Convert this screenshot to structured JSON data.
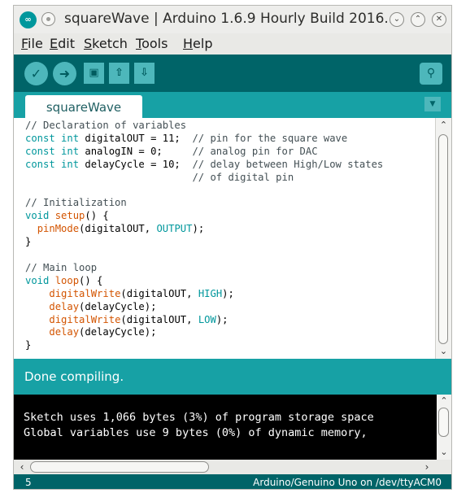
{
  "window": {
    "logo_text": "∞",
    "title": "squareWave | Arduino 1.6.9 Hourly Build 2016...",
    "minimize_icon": "chevron-down-icon",
    "maximize_icon": "chevron-up-icon",
    "close_icon": "close-icon"
  },
  "menu": {
    "items": [
      {
        "key": "F",
        "rest": "ile"
      },
      {
        "key": "E",
        "rest": "dit"
      },
      {
        "key": "S",
        "rest": "ketch"
      },
      {
        "key": "T",
        "rest": "ools"
      },
      {
        "key": "H",
        "rest": "elp"
      }
    ]
  },
  "toolbar": {
    "buttons": [
      "verify-icon",
      "upload-icon",
      "new-icon",
      "open-icon",
      "save-icon"
    ],
    "monitor_icon": "serial-monitor-icon"
  },
  "tabs": [
    {
      "label": "squareWave"
    }
  ],
  "code_lines": [
    [
      {
        "t": "// Declaration of variables",
        "c": "com"
      }
    ],
    [
      {
        "t": "const int ",
        "c": "kw"
      },
      {
        "t": "digitalOUT = 11;  ",
        "c": ""
      },
      {
        "t": "// pin for the square wave",
        "c": "com"
      }
    ],
    [
      {
        "t": "const int ",
        "c": "kw"
      },
      {
        "t": "analogIN = 0;     ",
        "c": ""
      },
      {
        "t": "// analog pin for DAC",
        "c": "com"
      }
    ],
    [
      {
        "t": "const int ",
        "c": "kw"
      },
      {
        "t": "delayCycle = 10;  ",
        "c": ""
      },
      {
        "t": "// delay between High/Low states",
        "c": "com"
      }
    ],
    [
      {
        "t": "                            // of digital pin",
        "c": "com"
      }
    ],
    [],
    [
      {
        "t": "// Initialization",
        "c": "com"
      }
    ],
    [
      {
        "t": "void ",
        "c": "kw"
      },
      {
        "t": "setup",
        "c": "fn"
      },
      {
        "t": "() {",
        "c": ""
      }
    ],
    [
      {
        "t": "  ",
        "c": ""
      },
      {
        "t": "pinMode",
        "c": "fn"
      },
      {
        "t": "(digitalOUT, ",
        "c": ""
      },
      {
        "t": "OUTPUT",
        "c": "kw"
      },
      {
        "t": ");",
        "c": ""
      }
    ],
    [
      {
        "t": "}",
        "c": ""
      }
    ],
    [],
    [
      {
        "t": "// Main loop",
        "c": "com"
      }
    ],
    [
      {
        "t": "void ",
        "c": "kw"
      },
      {
        "t": "loop",
        "c": "fn"
      },
      {
        "t": "() {",
        "c": ""
      }
    ],
    [
      {
        "t": "    ",
        "c": ""
      },
      {
        "t": "digitalWrite",
        "c": "fn"
      },
      {
        "t": "(digitalOUT, ",
        "c": ""
      },
      {
        "t": "HIGH",
        "c": "kw"
      },
      {
        "t": ");",
        "c": ""
      }
    ],
    [
      {
        "t": "    ",
        "c": ""
      },
      {
        "t": "delay",
        "c": "fn"
      },
      {
        "t": "(delayCycle);",
        "c": ""
      }
    ],
    [
      {
        "t": "    ",
        "c": ""
      },
      {
        "t": "digitalWrite",
        "c": "fn"
      },
      {
        "t": "(digitalOUT, ",
        "c": ""
      },
      {
        "t": "LOW",
        "c": "kw"
      },
      {
        "t": ");",
        "c": ""
      }
    ],
    [
      {
        "t": "    ",
        "c": ""
      },
      {
        "t": "delay",
        "c": "fn"
      },
      {
        "t": "(delayCycle);",
        "c": ""
      }
    ],
    [
      {
        "t": "}",
        "c": ""
      }
    ]
  ],
  "status": {
    "message": "Done compiling."
  },
  "console": {
    "lines": [
      "Sketch uses 1,066 bytes (3%) of program storage space",
      "Global variables use 9 bytes (0%) of dynamic memory,"
    ]
  },
  "footer": {
    "line_number": "5",
    "board": "Arduino/Genuino Uno on /dev/ttyACM0"
  },
  "colors": {
    "teal_dark": "#006468",
    "teal": "#17a1a5",
    "button": "#4db7bb",
    "keyword": "#00979c",
    "function": "#d35400",
    "comment": "#434f54"
  }
}
